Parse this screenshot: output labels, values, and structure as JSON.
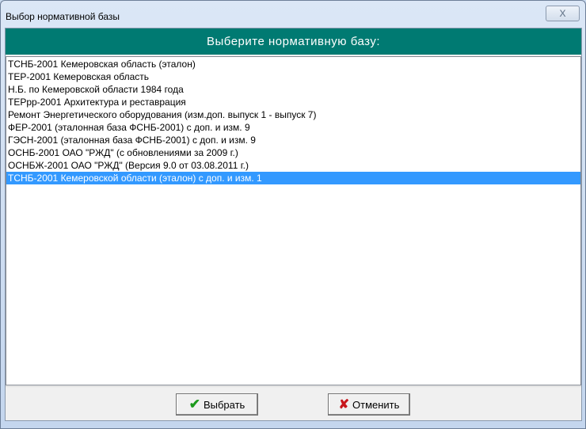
{
  "window": {
    "title": "Выбор нормативной базы",
    "close_label": "X"
  },
  "header": "Выберите нормативную базу:",
  "items": [
    "ТСНБ-2001 Кемеровская область (эталон)",
    "ТЕР-2001 Кемеровская область",
    "Н.Б. по Кемеровской области 1984 года",
    "ТЕРрр-2001 Архитектура и реставрация",
    "Ремонт Энергетического оборудования (изм.доп. выпуск 1 - выпуск 7)",
    "ФЕР-2001 (эталонная база ФСНБ-2001) с доп. и изм. 9",
    "ГЭСН-2001 (эталонная база ФСНБ-2001) с доп. и изм. 9",
    "ОСНБ-2001 ОАО \"РЖД\" (с обновлениями за 2009 г.)",
    "ОСНБЖ-2001 ОАО \"РЖД\" (Версия 9.0 от 03.08.2011 г.)",
    "ТСНБ-2001 Кемеровской области (эталон) с доп. и изм. 1"
  ],
  "selected_index": 9,
  "buttons": {
    "ok": "Выбрать",
    "cancel": "Отменить",
    "ok_icon": "✔",
    "cancel_icon": "✘"
  }
}
